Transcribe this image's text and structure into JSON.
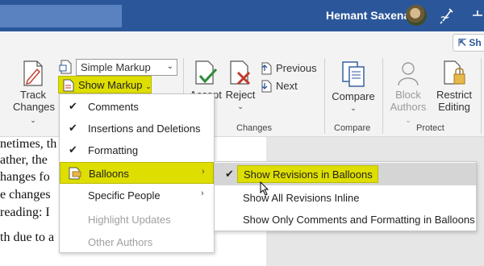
{
  "titlebar": {
    "user_name": "Hemant Saxena",
    "colors": {
      "bar": "#2b579a",
      "search": "#5b82c0"
    }
  },
  "share": {
    "label": "Sh"
  },
  "tracking": {
    "track_changes": [
      "Track",
      "Changes"
    ],
    "markup_select": "Simple Markup",
    "show_markup": "Show Markup"
  },
  "changes": {
    "accept": "Accept",
    "reject": "Reject",
    "previous": "Previous",
    "next": "Next",
    "group_label": "Changes"
  },
  "compare": {
    "label": "Compare",
    "group_label": "Compare"
  },
  "protect": {
    "block_authors": [
      "Block",
      "Authors"
    ],
    "restrict_editing": [
      "Restrict",
      "Editing"
    ],
    "group_label": "Protect"
  },
  "document": {
    "lines": [
      "netimes, th",
      "ather, the",
      "hanges fo",
      "e changes",
      " reading: I",
      "th due to a"
    ]
  },
  "menu": {
    "items": [
      {
        "label": "Comments",
        "checked": true
      },
      {
        "label": "Insertions and Deletions",
        "checked": true
      },
      {
        "label": "Formatting",
        "checked": true
      },
      {
        "label": "Balloons",
        "highlighted": true,
        "submenu": true
      },
      {
        "label": "Specific People",
        "submenu": true
      },
      {
        "label": "Highlight Updates",
        "disabled": true
      },
      {
        "label": "Other Authors",
        "disabled": true
      }
    ]
  },
  "submenu": {
    "items": [
      {
        "label": "Show Revisions in Balloons",
        "checked": true
      },
      {
        "label": "Show All Revisions Inline"
      },
      {
        "label": "Show Only Comments and Formatting in Balloons"
      }
    ]
  },
  "accent": {
    "highlight": "#dede00",
    "highlight_border": "#b9b900"
  }
}
